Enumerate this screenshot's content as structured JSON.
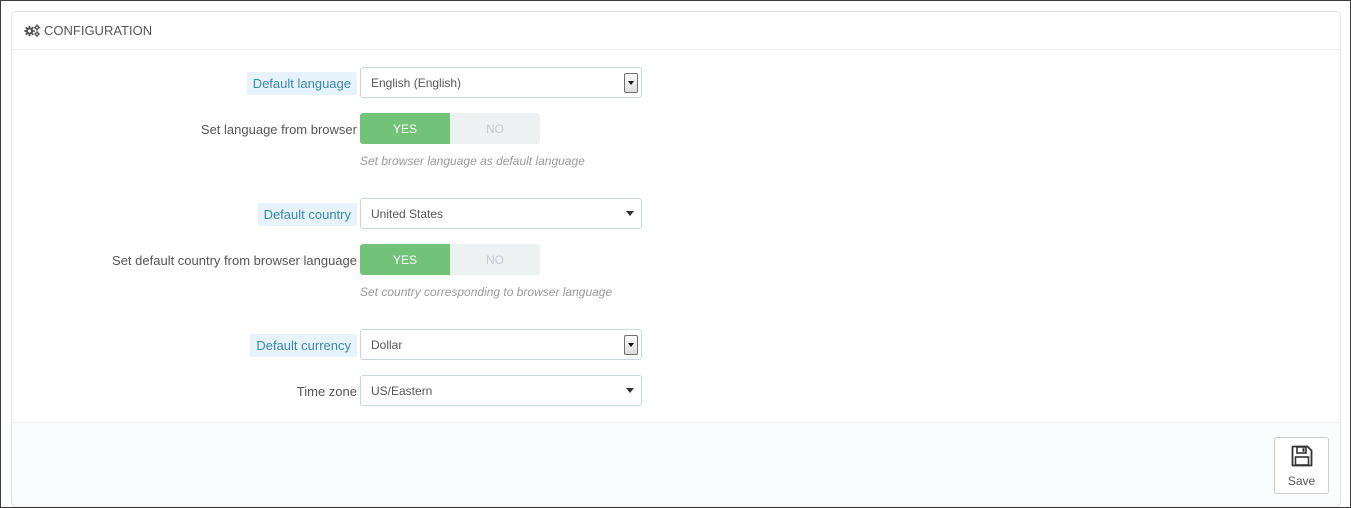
{
  "panel": {
    "title": "CONFIGURATION",
    "icon": "cogs-icon"
  },
  "fields": {
    "default_language": {
      "label": "Default language",
      "value": "English (English)"
    },
    "language_from_browser": {
      "label": "Set language from browser",
      "yes": "YES",
      "no": "NO",
      "selected": "YES",
      "help": "Set browser language as default language"
    },
    "default_country": {
      "label": "Default country",
      "value": "United States"
    },
    "country_from_browser": {
      "label": "Set default country from browser language",
      "yes": "YES",
      "no": "NO",
      "selected": "YES",
      "help": "Set country corresponding to browser language"
    },
    "default_currency": {
      "label": "Default currency",
      "value": "Dollar"
    },
    "time_zone": {
      "label": "Time zone",
      "value": "US/Eastern"
    }
  },
  "footer": {
    "save_label": "Save",
    "save_icon": "floppy-disk-icon"
  },
  "colors": {
    "switch_on": "#72c279",
    "hint_background": "#e7f3fa",
    "hint_text": "#3a87ad"
  }
}
